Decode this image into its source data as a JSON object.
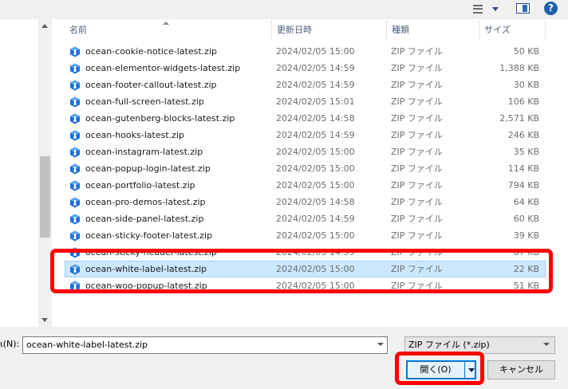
{
  "toolbar": {
    "view_icon": "view-details-icon",
    "pane_icon": "preview-pane-icon",
    "help_label": "?"
  },
  "columns": {
    "name": "名前",
    "date": "更新日時",
    "type": "種類",
    "size": "サイズ"
  },
  "files": [
    {
      "name": "ocean-cookie-notice-latest.zip",
      "date": "2024/02/05 15:00",
      "type": "ZIP ファイル",
      "size": "50 KB"
    },
    {
      "name": "ocean-elementor-widgets-latest.zip",
      "date": "2024/02/05 14:59",
      "type": "ZIP ファイル",
      "size": "1,388 KB"
    },
    {
      "name": "ocean-footer-callout-latest.zip",
      "date": "2024/02/05 14:59",
      "type": "ZIP ファイル",
      "size": "30 KB"
    },
    {
      "name": "ocean-full-screen-latest.zip",
      "date": "2024/02/05 15:01",
      "type": "ZIP ファイル",
      "size": "106 KB"
    },
    {
      "name": "ocean-gutenberg-blocks-latest.zip",
      "date": "2024/02/05 14:58",
      "type": "ZIP ファイル",
      "size": "2,571 KB"
    },
    {
      "name": "ocean-hooks-latest.zip",
      "date": "2024/02/05 14:59",
      "type": "ZIP ファイル",
      "size": "246 KB"
    },
    {
      "name": "ocean-instagram-latest.zip",
      "date": "2024/02/05 15:00",
      "type": "ZIP ファイル",
      "size": "35 KB"
    },
    {
      "name": "ocean-popup-login-latest.zip",
      "date": "2024/02/05 15:00",
      "type": "ZIP ファイル",
      "size": "114 KB"
    },
    {
      "name": "ocean-portfolio-latest.zip",
      "date": "2024/02/05 15:00",
      "type": "ZIP ファイル",
      "size": "794 KB"
    },
    {
      "name": "ocean-pro-demos-latest.zip",
      "date": "2024/02/05 14:58",
      "type": "ZIP ファイル",
      "size": "64 KB"
    },
    {
      "name": "ocean-side-panel-latest.zip",
      "date": "2024/02/05 14:59",
      "type": "ZIP ファイル",
      "size": "60 KB"
    },
    {
      "name": "ocean-sticky-footer-latest.zip",
      "date": "2024/02/05 15:00",
      "type": "ZIP ファイル",
      "size": "39 KB"
    },
    {
      "name": "ocean-sticky-header-latest.zip",
      "date": "2024/02/05 14:59",
      "type": "ZIP ファイル",
      "size": "67 KB"
    },
    {
      "name": "ocean-white-label-latest.zip",
      "date": "2024/02/05 15:00",
      "type": "ZIP ファイル",
      "size": "22 KB",
      "selected": true
    },
    {
      "name": "ocean-woo-popup-latest.zip",
      "date": "2024/02/05 15:00",
      "type": "ZIP ファイル",
      "size": "51 KB"
    }
  ],
  "bottom": {
    "filename_label": "ι(N):",
    "filename_value": "ocean-white-label-latest.zip",
    "filter_value": "ZIP ファイル (*.zip)",
    "open_label": "開く(O)",
    "cancel_label": "キャンセル"
  },
  "colors": {
    "selection": "#cce8ff",
    "highlight": "#ff0000",
    "accent": "#0078d7"
  }
}
